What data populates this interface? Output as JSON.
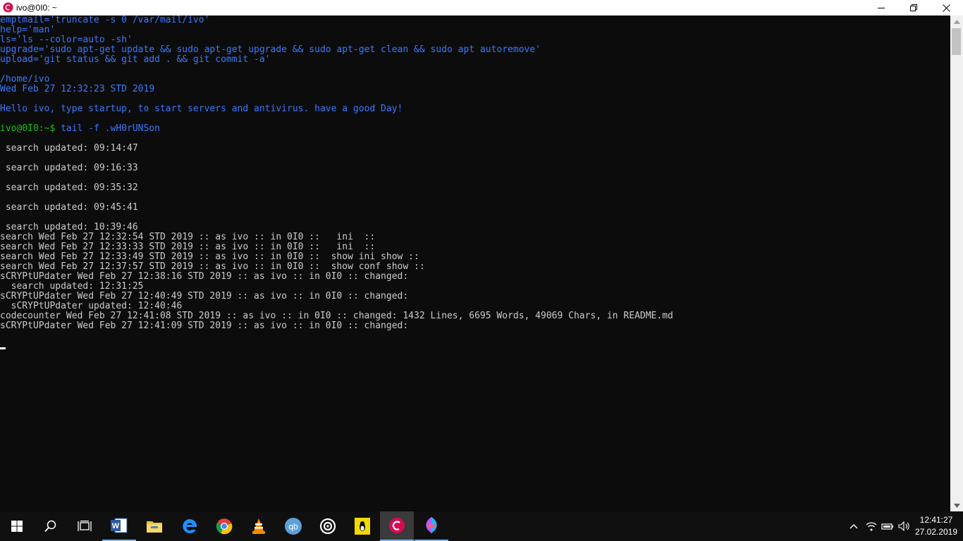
{
  "window": {
    "title": "ivo@0I0: ~",
    "minimize_label": "─",
    "close_label": "✕"
  },
  "terminal": {
    "lines": [
      {
        "text": "emptmail='truncate -s 0 /var/mail/ivo'",
        "color": "blue"
      },
      {
        "text": "help='man'",
        "color": "blue"
      },
      {
        "text": "ls='ls --color=auto -sh'",
        "color": "blue"
      },
      {
        "text": "upgrade='sudo apt-get update && sudo apt-get upgrade && sudo apt-get clean && sudo apt autoremove'",
        "color": "blue"
      },
      {
        "text": "upload='git status && git add . && git commit -a'",
        "color": "blue"
      },
      {
        "text": "",
        "color": "white"
      },
      {
        "text": "/home/ivo",
        "color": "blue"
      },
      {
        "text": "Wed Feb 27 12:32:23 STD 2019",
        "color": "blue"
      },
      {
        "text": "",
        "color": "white"
      },
      {
        "text": "Hello ivo, type startup, to start servers and antivirus. have a good Day!",
        "color": "blue"
      },
      {
        "text": "",
        "color": "white"
      },
      {
        "prompt": "ivo@0I0:~$",
        "text": " tail -f .wH0rUNSon",
        "color": "blue"
      },
      {
        "text": "",
        "color": "white"
      },
      {
        "text": " search updated: 09:14:47",
        "color": "white"
      },
      {
        "text": "",
        "color": "white"
      },
      {
        "text": " search updated: 09:16:33",
        "color": "white"
      },
      {
        "text": "",
        "color": "white"
      },
      {
        "text": " search updated: 09:35:32",
        "color": "white"
      },
      {
        "text": "",
        "color": "white"
      },
      {
        "text": " search updated: 09:45:41",
        "color": "white"
      },
      {
        "text": "",
        "color": "white"
      },
      {
        "text": " search updated: 10:39:46",
        "color": "white"
      },
      {
        "text": "search Wed Feb 27 12:32:54 STD 2019 :: as ivo :: in 0I0 ::   ini  ::",
        "color": "white"
      },
      {
        "text": "search Wed Feb 27 12:33:33 STD 2019 :: as ivo :: in 0I0 ::   ini  ::",
        "color": "white"
      },
      {
        "text": "search Wed Feb 27 12:33:49 STD 2019 :: as ivo :: in 0I0 ::  show ini show ::",
        "color": "white"
      },
      {
        "text": "search Wed Feb 27 12:37:57 STD 2019 :: as ivo :: in 0I0 ::  show conf show ::",
        "color": "white"
      },
      {
        "text": "sCRYPtUPdater Wed Feb 27 12:38:16 STD 2019 :: as ivo :: in 0I0 :: changed:",
        "color": "white"
      },
      {
        "text": "  search updated: 12:31:25",
        "color": "white"
      },
      {
        "text": "sCRYPtUPdater Wed Feb 27 12:40:49 STD 2019 :: as ivo :: in 0I0 :: changed:",
        "color": "white"
      },
      {
        "text": "  sCRYPtUPdater updated: 12:40:46",
        "color": "white"
      },
      {
        "text": "codecounter Wed Feb 27 12:41:08 STD 2019 :: as ivo :: in 0I0 :: changed: 1432 Lines, 6695 Words, 49069 Chars, in README.md",
        "color": "white"
      },
      {
        "text": "sCRYPtUPdater Wed Feb 27 12:41:09 STD 2019 :: as ivo :: in 0I0 :: changed:",
        "color": "white"
      },
      {
        "text": "",
        "color": "white"
      }
    ]
  },
  "taskbar": {
    "items": [
      {
        "name": "start-button",
        "icon": "windows-logo-icon"
      },
      {
        "name": "search-button",
        "icon": "search-icon"
      },
      {
        "name": "task-view-button",
        "icon": "task-view-icon"
      },
      {
        "name": "word-taskbar-item",
        "icon": "word-icon"
      },
      {
        "name": "file-explorer-taskbar-item",
        "icon": "folder-icon"
      },
      {
        "name": "edge-taskbar-item",
        "icon": "edge-icon"
      },
      {
        "name": "chrome-taskbar-item",
        "icon": "chrome-icon"
      },
      {
        "name": "vlc-taskbar-item",
        "icon": "vlc-cone-icon"
      },
      {
        "name": "qbittorrent-taskbar-item",
        "icon": "qbittorrent-icon"
      },
      {
        "name": "target-app-taskbar-item",
        "icon": "target-icon"
      },
      {
        "name": "linux-app-taskbar-item",
        "icon": "tux-icon"
      },
      {
        "name": "debian-terminal-taskbar-item",
        "icon": "debian-swirl-icon"
      },
      {
        "name": "paint-taskbar-item",
        "icon": "paint-drop-icon"
      }
    ],
    "tray": {
      "chevron": "chevron-up-icon",
      "wifi": "wifi-icon",
      "battery": "battery-icon",
      "volume": "volume-icon"
    },
    "clock": {
      "time": "12:41:27",
      "date": "27.02.2019"
    },
    "qb_label": "qb"
  },
  "colors": {
    "terminal_bg": "#0c0c0c",
    "blue": "#3b78ff",
    "green": "#16c60c",
    "text": "#cccccc",
    "debian_red": "#d70a53"
  }
}
